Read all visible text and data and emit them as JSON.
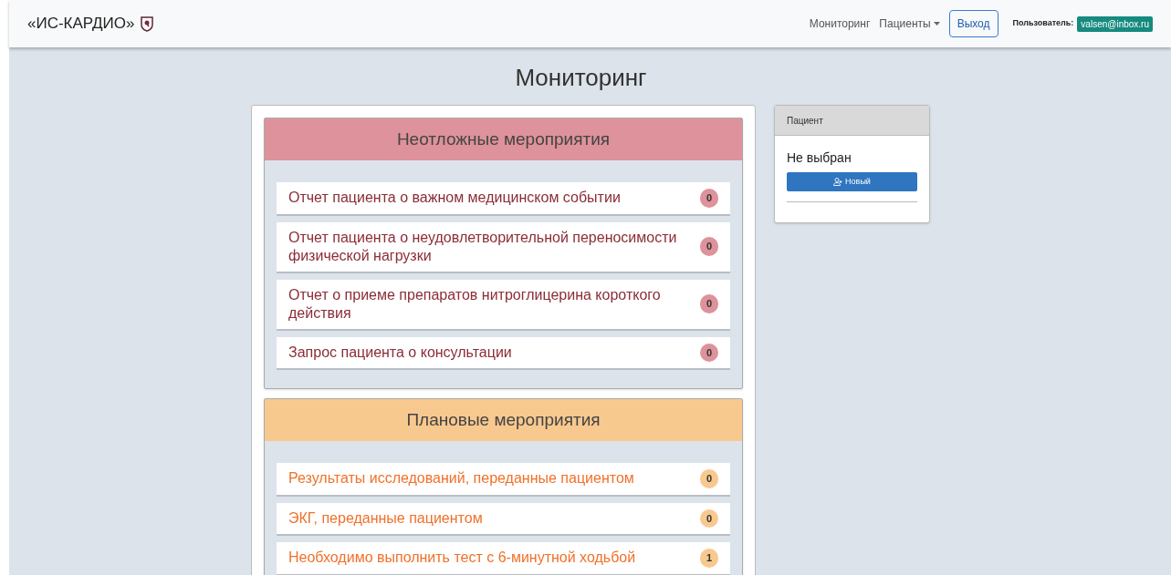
{
  "navbar": {
    "brand": "«ИС-КАРДИО»",
    "links": [
      {
        "label": "Мониторинг",
        "kind": "link"
      },
      {
        "label": "Пациенты",
        "kind": "dropdown"
      }
    ],
    "logout": "Выход",
    "user_label": "Пользователь:",
    "user_email": "valsen@inbox.ru"
  },
  "page_title": "Мониторинг",
  "sections": [
    {
      "kind": "urgent",
      "title": "Неотложные мероприятия",
      "items": [
        {
          "label": "Отчет пациента о важном медицинском событии",
          "count": "0"
        },
        {
          "label": "Отчет пациента о неудовлетворительной переносимости физической нагрузки",
          "count": "0"
        },
        {
          "label": "Отчет о приеме препаратов нитроглицерина короткого действия",
          "count": "0"
        },
        {
          "label": "Запрос пациента о консультации",
          "count": "0"
        }
      ]
    },
    {
      "kind": "planned",
      "title": "Плановые мероприятия",
      "items": [
        {
          "label": "Результаты исследований, переданные пациентом",
          "count": "0"
        },
        {
          "label": "ЭКГ, переданные пациентом",
          "count": "0"
        },
        {
          "label": "Необходимо выполнить тест с 6-минутной ходьбой",
          "count": "1"
        }
      ]
    }
  ],
  "patient_card": {
    "header": "Пациент",
    "status": "Не выбран",
    "new_button": "Новый"
  }
}
